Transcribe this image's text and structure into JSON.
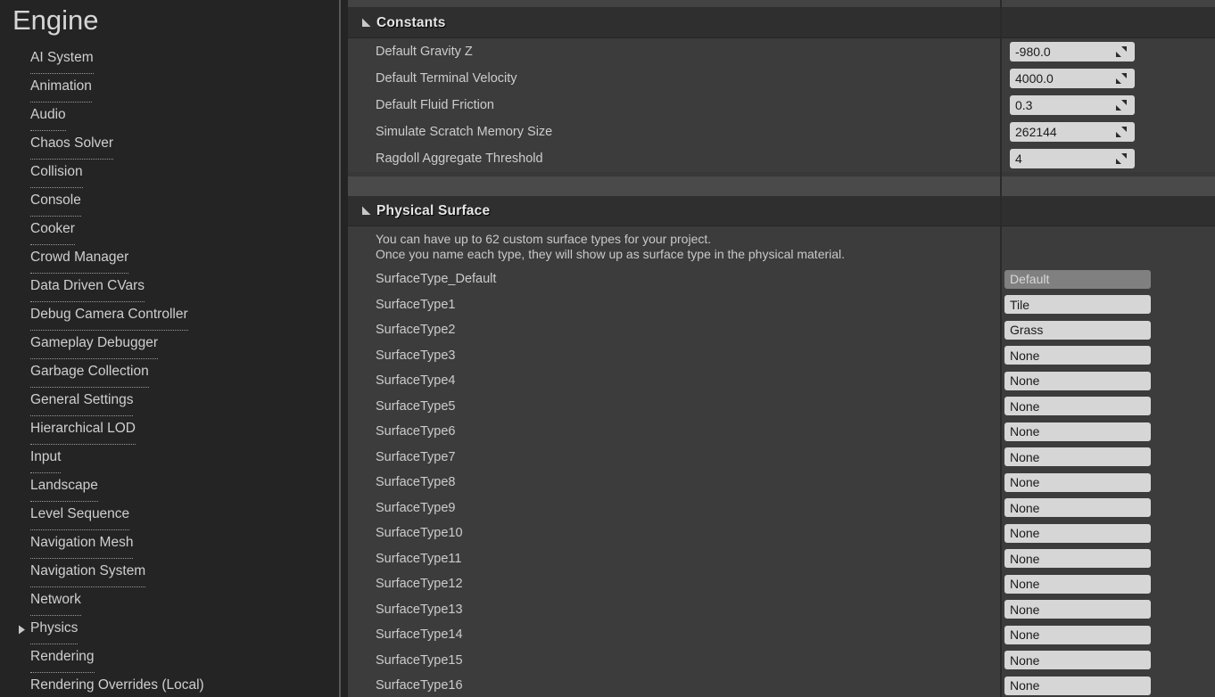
{
  "sidebar": {
    "title": "Engine",
    "items": [
      {
        "label": "AI System",
        "expandable": false
      },
      {
        "label": "Animation",
        "expandable": false
      },
      {
        "label": "Audio",
        "expandable": false
      },
      {
        "label": "Chaos Solver",
        "expandable": false
      },
      {
        "label": "Collision",
        "expandable": false
      },
      {
        "label": "Console",
        "expandable": false
      },
      {
        "label": "Cooker",
        "expandable": false
      },
      {
        "label": "Crowd Manager",
        "expandable": false
      },
      {
        "label": "Data Driven CVars",
        "expandable": false
      },
      {
        "label": "Debug Camera Controller",
        "expandable": false
      },
      {
        "label": "Gameplay Debugger",
        "expandable": false
      },
      {
        "label": "Garbage Collection",
        "expandable": false
      },
      {
        "label": "General Settings",
        "expandable": false
      },
      {
        "label": "Hierarchical LOD",
        "expandable": false
      },
      {
        "label": "Input",
        "expandable": false
      },
      {
        "label": "Landscape",
        "expandable": false
      },
      {
        "label": "Level Sequence",
        "expandable": false
      },
      {
        "label": "Navigation Mesh",
        "expandable": false
      },
      {
        "label": "Navigation System",
        "expandable": false
      },
      {
        "label": "Network",
        "expandable": false
      },
      {
        "label": "Physics",
        "expandable": true
      },
      {
        "label": "Rendering",
        "expandable": false
      },
      {
        "label": "Rendering Overrides (Local)",
        "expandable": false
      }
    ]
  },
  "details": {
    "sections": [
      {
        "title": "Constants",
        "expanded": true,
        "rows": [
          {
            "label": "Default Gravity Z",
            "value": "-980.0"
          },
          {
            "label": "Default Terminal Velocity",
            "value": "4000.0"
          },
          {
            "label": "Default Fluid Friction",
            "value": "0.3"
          },
          {
            "label": "Simulate Scratch Memory Size",
            "value": "262144"
          },
          {
            "label": "Ragdoll Aggregate Threshold",
            "value": "4"
          }
        ]
      },
      {
        "title": "Physical Surface",
        "expanded": true,
        "description": [
          "You can have up to 62 custom surface types for your project.",
          "Once you name each type, they will show up as surface type in the physical material."
        ],
        "rows": [
          {
            "label": "SurfaceType_Default",
            "value": "Default",
            "disabled": true
          },
          {
            "label": "SurfaceType1",
            "value": "Tile",
            "disabled": false
          },
          {
            "label": "SurfaceType2",
            "value": "Grass",
            "disabled": false
          },
          {
            "label": "SurfaceType3",
            "value": "None",
            "disabled": false
          },
          {
            "label": "SurfaceType4",
            "value": "None",
            "disabled": false
          },
          {
            "label": "SurfaceType5",
            "value": "None",
            "disabled": false
          },
          {
            "label": "SurfaceType6",
            "value": "None",
            "disabled": false
          },
          {
            "label": "SurfaceType7",
            "value": "None",
            "disabled": false
          },
          {
            "label": "SurfaceType8",
            "value": "None",
            "disabled": false
          },
          {
            "label": "SurfaceType9",
            "value": "None",
            "disabled": false
          },
          {
            "label": "SurfaceType10",
            "value": "None",
            "disabled": false
          },
          {
            "label": "SurfaceType11",
            "value": "None",
            "disabled": false
          },
          {
            "label": "SurfaceType12",
            "value": "None",
            "disabled": false
          },
          {
            "label": "SurfaceType13",
            "value": "None",
            "disabled": false
          },
          {
            "label": "SurfaceType14",
            "value": "None",
            "disabled": false
          },
          {
            "label": "SurfaceType15",
            "value": "None",
            "disabled": false
          },
          {
            "label": "SurfaceType16",
            "value": "None",
            "disabled": false
          }
        ]
      }
    ]
  },
  "icons": {
    "collapse_triangle": "triangle-down-icon",
    "expand_triangle": "triangle-right-icon",
    "numeric_drag": "drag-arrows-icon"
  },
  "colors": {
    "panel_bg": "#383838",
    "row_bg": "#3c3c3c",
    "header_bg": "#2f2f2f",
    "sidebar_bg": "#242424",
    "field_bg": "#d6d6d6",
    "field_disabled_bg": "#808080",
    "text_primary": "#cccccc",
    "text_heading": "#e6e6e6"
  }
}
